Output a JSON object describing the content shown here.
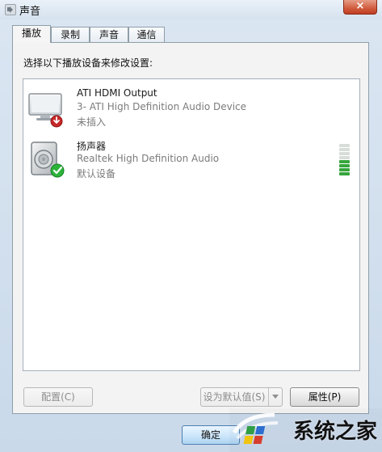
{
  "window": {
    "title": "声音",
    "close": "×"
  },
  "tabs": [
    {
      "label": "播放",
      "active": true
    },
    {
      "label": "录制",
      "active": false
    },
    {
      "label": "声音",
      "active": false
    },
    {
      "label": "通信",
      "active": false
    }
  ],
  "panel": {
    "instruction": "选择以下播放设备来修改设置:"
  },
  "devices": [
    {
      "name": "ATI HDMI Output",
      "description": "3- ATI High Definition Audio Device",
      "status": "未插入",
      "icon": "monitor-speaker-icon"
    },
    {
      "name": "扬声器",
      "description": "Realtek High Definition Audio",
      "status": "默认设备",
      "icon": "speaker-icon",
      "level_fraction": 0.6
    }
  ],
  "buttons": {
    "configure": "配置(C)",
    "set_default": "设为默认值(S)",
    "properties": "属性(P)",
    "ok": "确定"
  },
  "watermark": {
    "text": "系统之家"
  },
  "colors": {
    "accent_green": "#2db33a",
    "disconnected_red": "#c62828",
    "meter_green": "#37a53d"
  }
}
